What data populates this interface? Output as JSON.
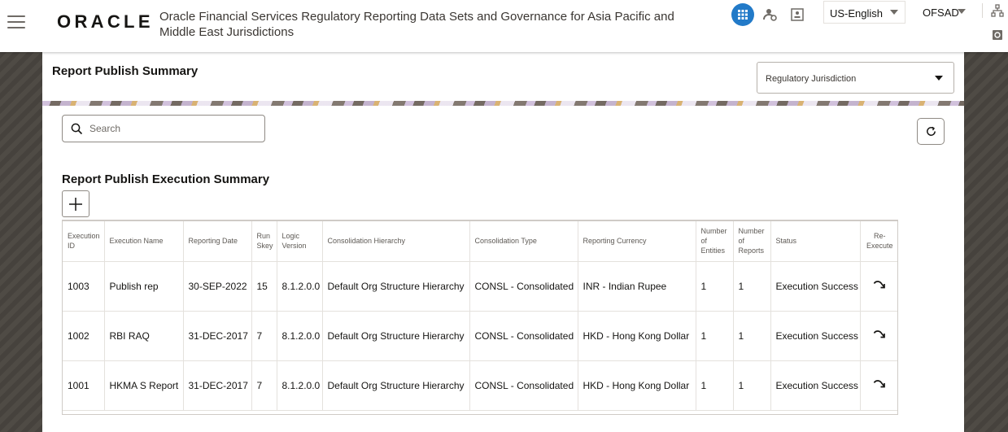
{
  "header": {
    "logo_text": "ORACLE",
    "app_title": "Oracle Financial Services Regulatory Reporting Data Sets and Governance for Asia Pacific and Middle East Jurisdictions",
    "language": "US-English",
    "user": "OFSAD",
    "accent_color": "#227ac8"
  },
  "page": {
    "title": "Report Publish Summary",
    "jurisdiction_placeholder": "Regulatory Jurisdiction",
    "search_placeholder": "Search",
    "section_title": "Report Publish Execution Summary"
  },
  "table": {
    "columns": [
      "Execution ID",
      "Execution Name",
      "Reporting Date",
      "Run Skey",
      "Logic Version",
      "Consolidation Hierarchy",
      "Consolidation Type",
      "Reporting Currency",
      "Number of Entities",
      "Number of Reports",
      "Status",
      "Re-Execute"
    ],
    "rows": [
      {
        "id": "1003",
        "name": "Publish rep",
        "date": "30-SEP-2022",
        "skey": "15",
        "version": "8.1.2.0.0",
        "hierarchy": "Default Org Structure Hierarchy",
        "type": "CONSL - Consolidated",
        "currency": "INR - Indian Rupee",
        "entities": "1",
        "reports": "1",
        "status": "Execution Success"
      },
      {
        "id": "1002",
        "name": "RBI RAQ",
        "date": "31-DEC-2017",
        "skey": "7",
        "version": "8.1.2.0.0",
        "hierarchy": "Default Org Structure Hierarchy",
        "type": "CONSL - Consolidated",
        "currency": "HKD - Hong Kong Dollar",
        "entities": "1",
        "reports": "1",
        "status": "Execution Success"
      },
      {
        "id": "1001",
        "name": "HKMA S Report",
        "date": "31-DEC-2017",
        "skey": "7",
        "version": "8.1.2.0.0",
        "hierarchy": "Default Org Structure Hierarchy",
        "type": "CONSL - Consolidated",
        "currency": "HKD - Hong Kong Dollar",
        "entities": "1",
        "reports": "1",
        "status": "Execution Success"
      }
    ]
  }
}
